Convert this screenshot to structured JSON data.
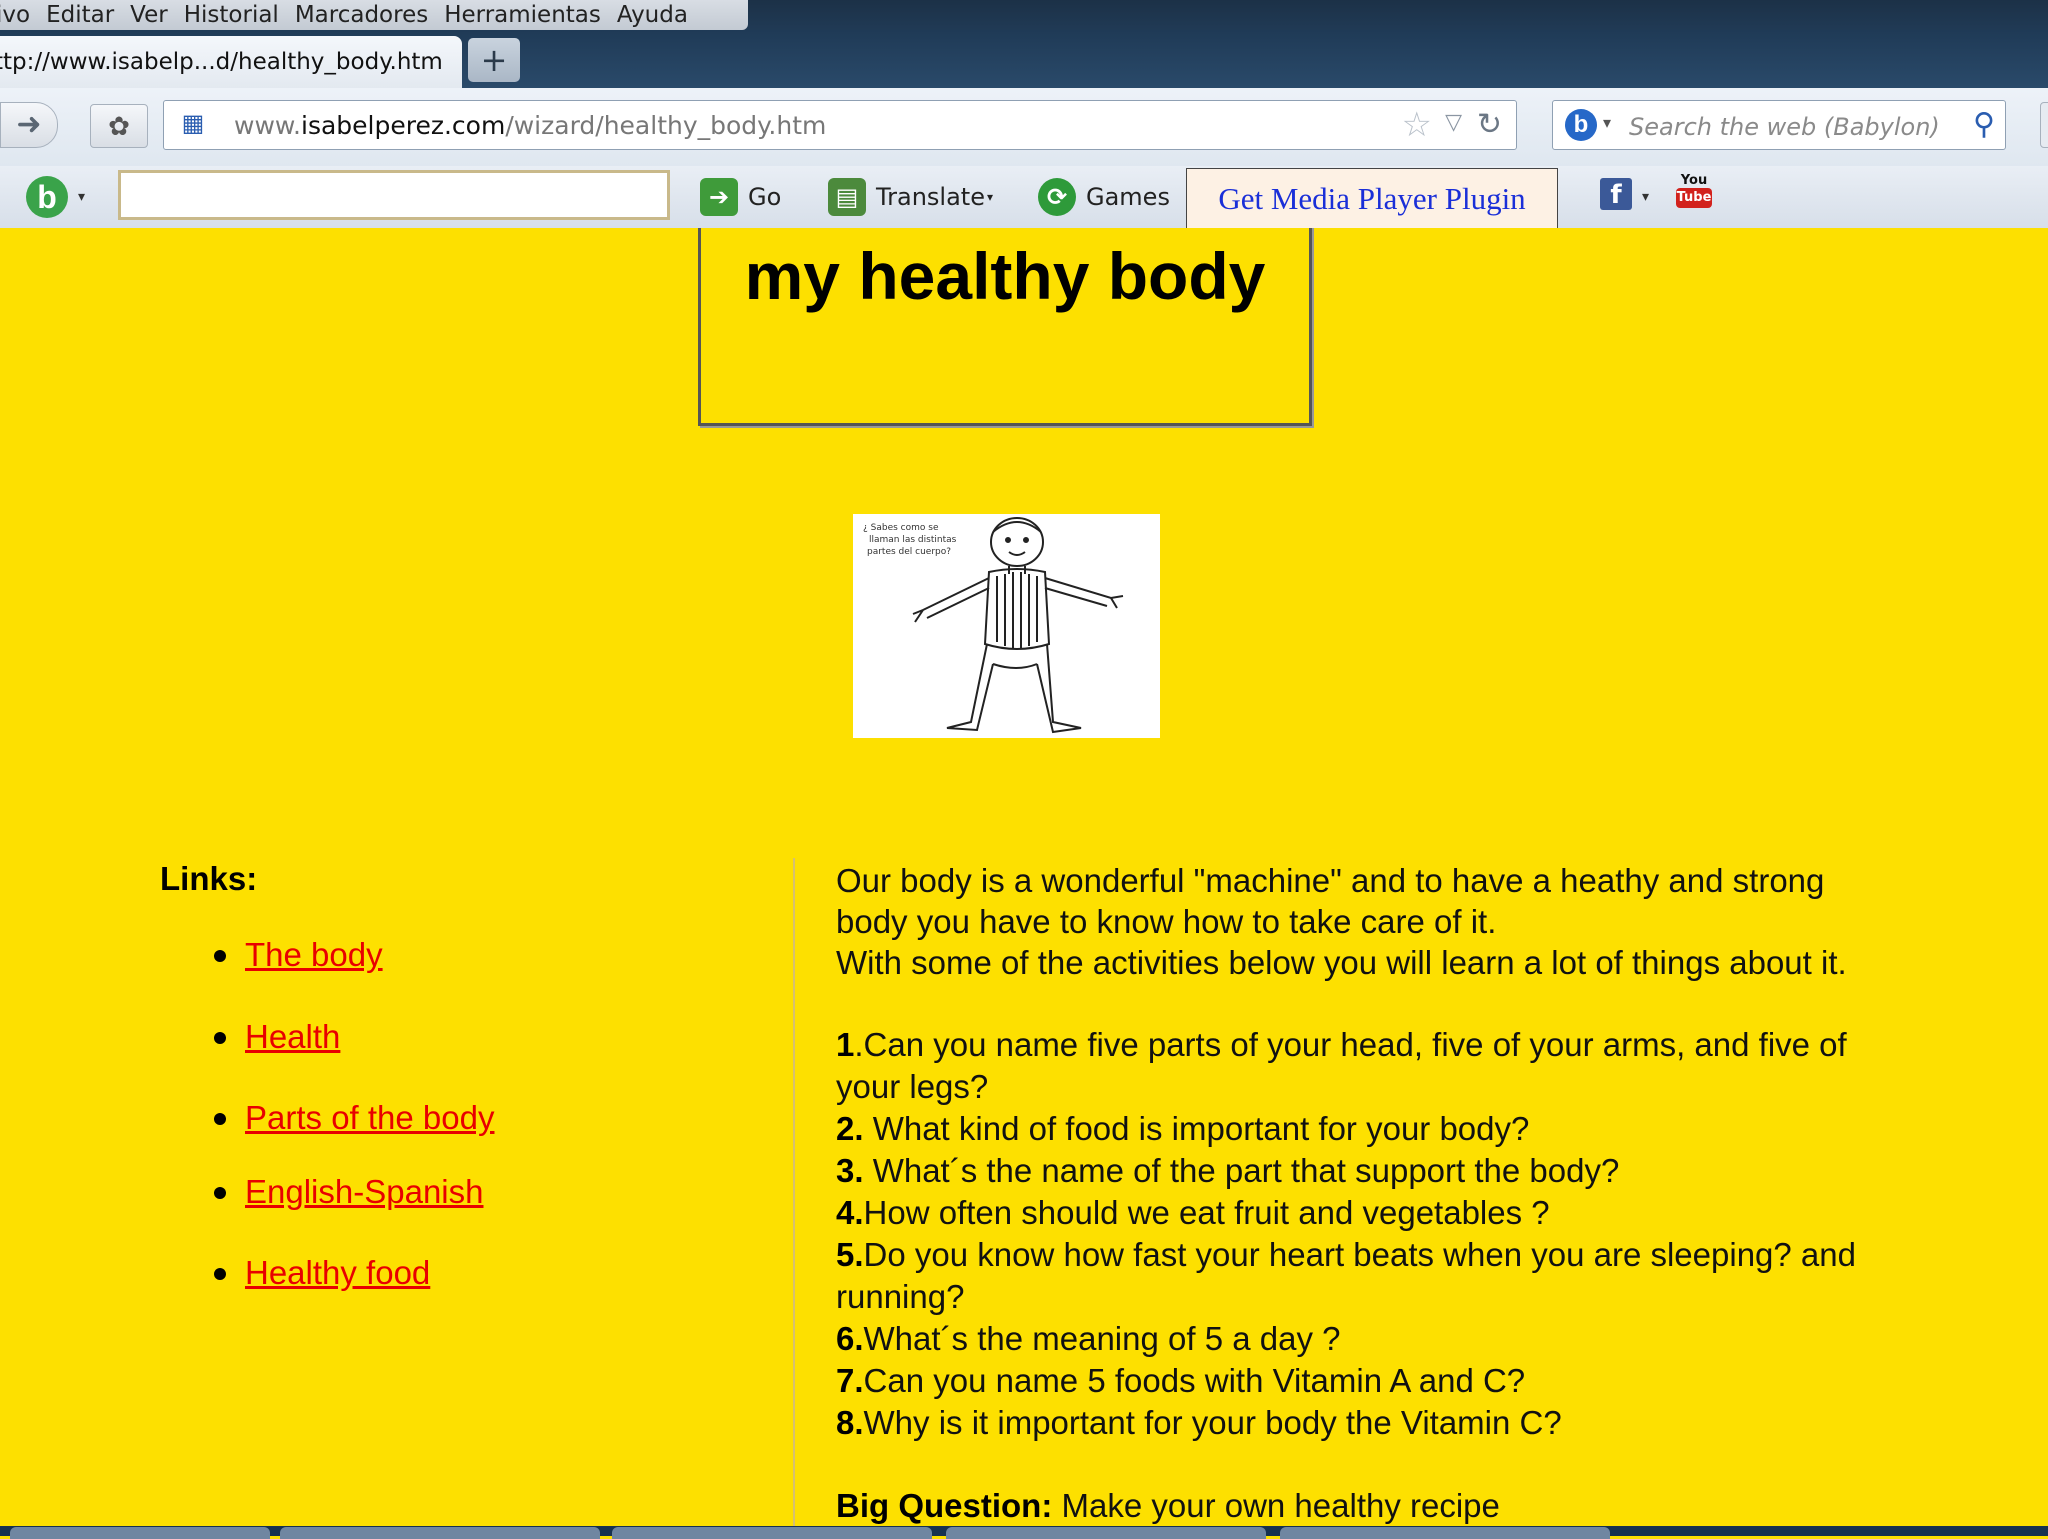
{
  "menubar": {
    "items": [
      "ivo",
      "Editar",
      "Ver",
      "Historial",
      "Marcadores",
      "Herramientas",
      "Ayuda"
    ]
  },
  "tab": {
    "title": "ttp://www.isabelp...d/healthy_body.htm",
    "new_tab_symbol": "+"
  },
  "navbar": {
    "url_prefix": "www.",
    "url_domain": "isabelperez.com",
    "url_path": "/wizard/healthy_body.htm",
    "search_placeholder": "Search the web (Babylon)"
  },
  "toolbar": {
    "go_label": "Go",
    "translate_label": "Translate",
    "games_label": "Games",
    "media_plugin_label": "Get Media Player Plugin",
    "youtube_top": "You",
    "youtube_bottom": "Tube"
  },
  "page": {
    "title": "my healthy body",
    "links_heading": "Links:",
    "links": [
      "The body",
      "Health",
      "Parts of the body",
      "English-Spanish",
      "Healthy food"
    ],
    "image_caption": "¿ Sabes como se llaman las distintas partes del cuerpo?",
    "intro_lines": [
      "Our body is a wonderful \"machine\" and to have a heathy and strong",
      "body you have to know how to take care of it.",
      "With some of the activities below you will learn a lot of things about it."
    ],
    "questions": [
      {
        "num": "1",
        "sep": ".",
        "text": "Can you name five parts of your head, five of your arms, and five of your legs?"
      },
      {
        "num": "2.",
        "sep": " ",
        "text": "What kind of food is important for your body?"
      },
      {
        "num": "3.",
        "sep": " ",
        "text": "What´s the name of the part that support the body?"
      },
      {
        "num": "4.",
        "sep": "",
        "text": "How often should we eat fruit and vegetables ?"
      },
      {
        "num": "5.",
        "sep": "",
        "text": "Do you know how fast your heart beats when you are sleeping? and running?"
      },
      {
        "num": "6.",
        "sep": "",
        "text": "What´s the meaning of 5 a day ?"
      },
      {
        "num": "7.",
        "sep": "",
        "text": "Can you name 5 foods with Vitamin A and C?"
      },
      {
        "num": "8.",
        "sep": "",
        "text": "Why is it important for your body the Vitamin C?"
      }
    ],
    "big_question_label": "Big Question:",
    "big_question_text": " Make your own healthy recipe"
  },
  "colors": {
    "page_background": "#fde000",
    "link_color": "#e80000",
    "media_plugin_text": "#1a2fd8"
  }
}
